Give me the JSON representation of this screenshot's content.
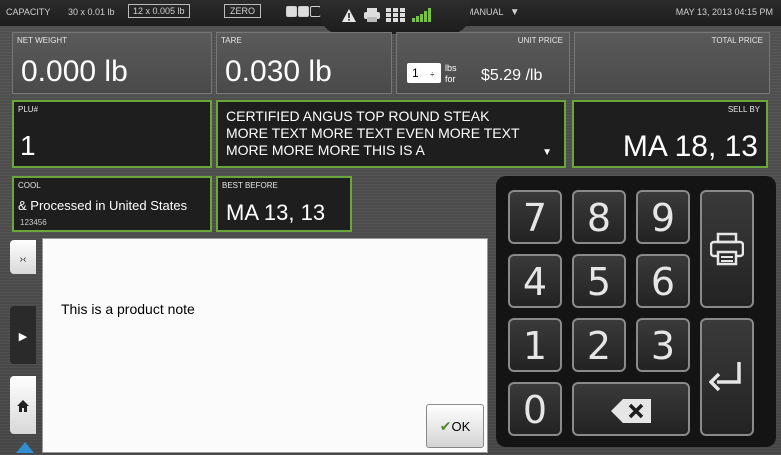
{
  "topbar": {
    "capacity_label": "CAPACITY",
    "capacity_range1": "30 x 0.01 lb",
    "capacity_range2": "12 x 0.005 lb",
    "zero_label": "ZERO",
    "mode_label": "MANUAL",
    "datetime": "MAY 13, 2013 04:15 PM"
  },
  "fields": {
    "net_weight": {
      "label": "NET WEIGHT",
      "value": "0.000 lb"
    },
    "tare": {
      "label": "TARE",
      "value": "0.030 lb"
    },
    "unit_price": {
      "label": "UNIT PRICE",
      "qty": "1",
      "unit_top": "lbs",
      "unit_bottom": "for",
      "value": "$5.29 /lb"
    },
    "total_price": {
      "label": "TOTAL PRICE",
      "value": ""
    },
    "plu": {
      "label": "PLU#",
      "value": "1"
    },
    "description": "CERTIFIED ANGUS TOP ROUND STEAK MORE TEXT MORE TEXT EVEN MORE TEXT MORE MORE MORE THIS IS A",
    "sell_by": {
      "label": "SELL BY",
      "value": "MA 18, 13"
    },
    "cool": {
      "label": "COOL",
      "value": "& Processed in United States",
      "code": "123456"
    },
    "best_before": {
      "label": "BEST BEFORE",
      "value": "MA 13, 13"
    }
  },
  "dialog": {
    "note": "This is a product note",
    "ok_label": "OK"
  },
  "keypad": {
    "keys": [
      "7",
      "8",
      "9",
      "4",
      "5",
      "6",
      "1",
      "2",
      "3",
      "0"
    ]
  },
  "colors": {
    "accent_green": "#6aa63a",
    "panel_dark": "#1e1e1e"
  }
}
